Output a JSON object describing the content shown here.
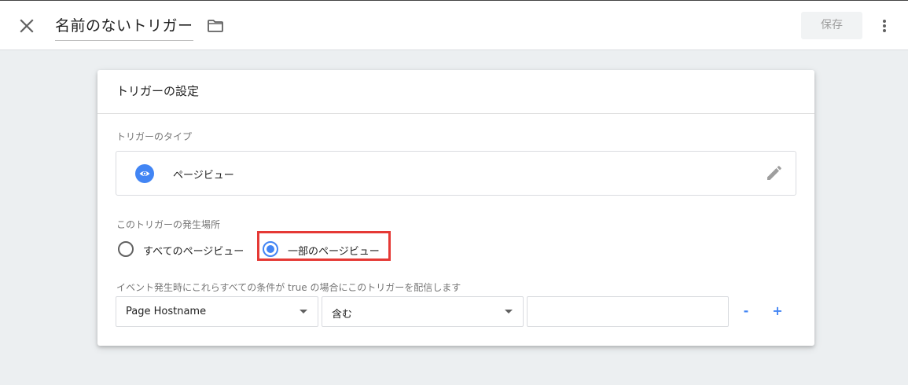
{
  "header": {
    "title": "名前のないトリガー",
    "save_label": "保存"
  },
  "card": {
    "title": "トリガーの設定",
    "trigger_type": {
      "label": "トリガーのタイプ",
      "value": "ページビュー",
      "icon": "eye-icon"
    },
    "fire_on": {
      "label": "このトリガーの発生場所",
      "options": [
        {
          "label": "すべてのページビュー",
          "selected": false
        },
        {
          "label": "一部のページビュー",
          "selected": true
        }
      ]
    },
    "condition": {
      "label": "イベント発生時にこれらすべての条件が true の場合にこのトリガーを配信します",
      "variable": "Page Hostname",
      "operator": "含む",
      "value": "",
      "remove_label": "-",
      "add_label": "+"
    }
  },
  "colors": {
    "accent": "#4285f4",
    "highlight": "#e53935",
    "background": "#eceff1"
  }
}
